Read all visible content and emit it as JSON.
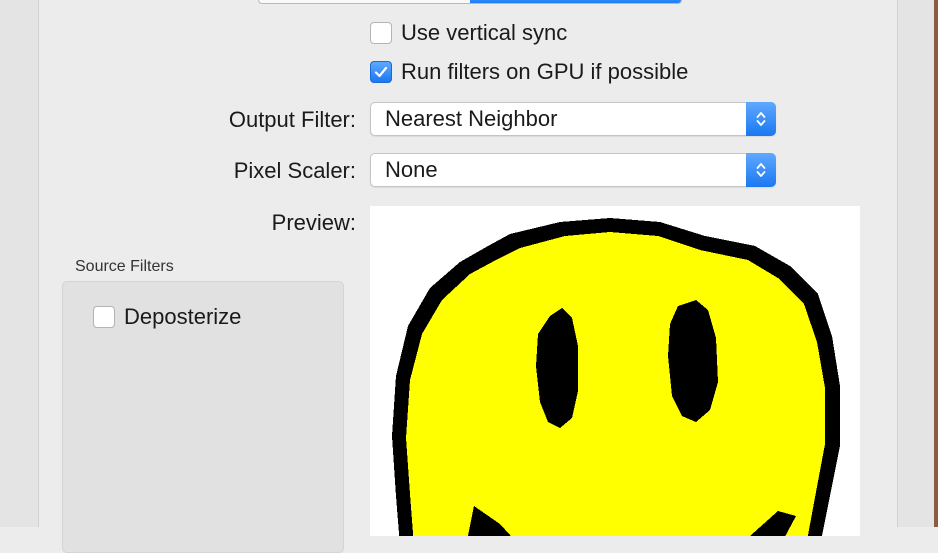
{
  "display": {
    "vsync_label": "Use vertical sync",
    "vsync_checked": false,
    "gpu_label": "Run filters on GPU if possible",
    "gpu_checked": true,
    "output_filter_label": "Output Filter:",
    "output_filter_value": "Nearest Neighbor",
    "pixel_scaler_label": "Pixel Scaler:",
    "pixel_scaler_value": "None",
    "preview_label": "Preview:"
  },
  "source_filters": {
    "title": "Source Filters",
    "items": [
      {
        "label": "Deposterize",
        "checked": false
      }
    ]
  },
  "colors": {
    "accent": "#1a78f2",
    "smiley_fill": "#ffff00",
    "smiley_outline": "#000000"
  }
}
